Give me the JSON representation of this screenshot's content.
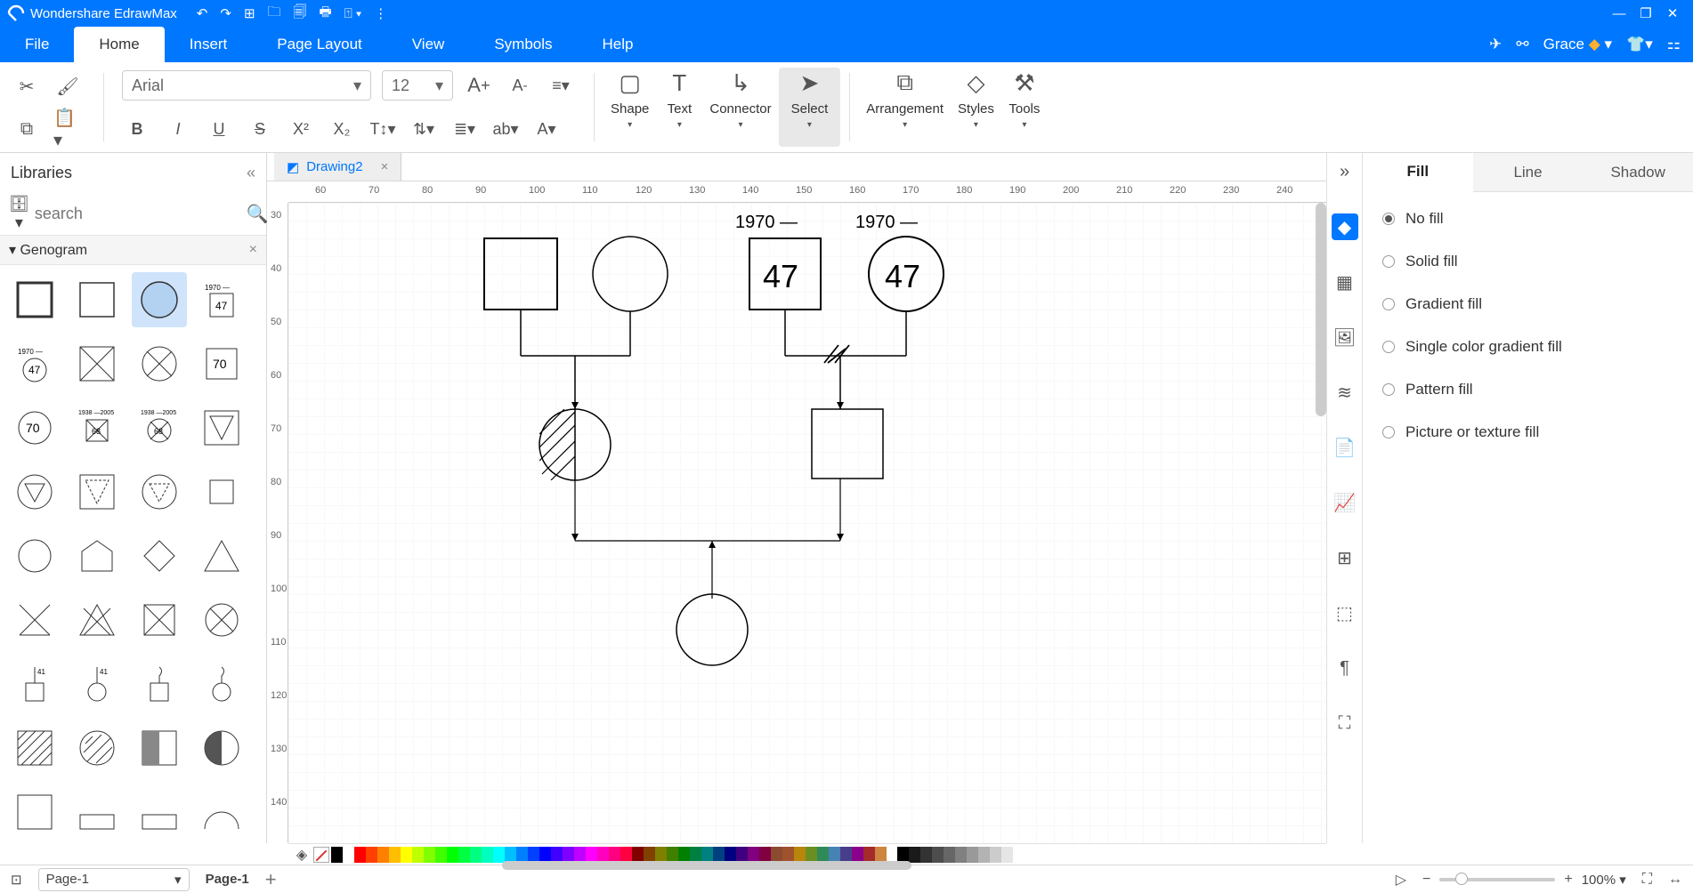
{
  "app": {
    "title": "Wondershare EdrawMax"
  },
  "titlebar_icons": [
    "undo",
    "redo",
    "new",
    "open",
    "recent",
    "print",
    "export",
    "more"
  ],
  "menus": [
    "File",
    "Home",
    "Insert",
    "Page Layout",
    "View",
    "Symbols",
    "Help"
  ],
  "active_menu": "Home",
  "user": {
    "name": "Grace"
  },
  "font": {
    "family": "Arial",
    "size": "12"
  },
  "ribbon": {
    "shape": "Shape",
    "text": "Text",
    "connector": "Connector",
    "select": "Select",
    "arrangement": "Arrangement",
    "styles": "Styles",
    "tools": "Tools"
  },
  "libraries": {
    "title": "Libraries",
    "search_placeholder": "search",
    "category": "Genogram"
  },
  "doc_tab": "Drawing2",
  "ruler_x": [
    "60",
    "70",
    "80",
    "90",
    "100",
    "110",
    "120",
    "130",
    "140",
    "150",
    "160",
    "170",
    "180",
    "190",
    "200",
    "210",
    "220",
    "230",
    "240"
  ],
  "ruler_y": [
    "30",
    "40",
    "50",
    "60",
    "70",
    "80",
    "90",
    "100",
    "110",
    "120",
    "130",
    "140"
  ],
  "canvas": {
    "label1970a": "1970 —",
    "label1970b": "1970 —",
    "num47a": "47",
    "num47b": "47"
  },
  "rightpanel": {
    "tabs": [
      "Fill",
      "Line",
      "Shadow"
    ],
    "active": "Fill",
    "options": [
      "No fill",
      "Solid fill",
      "Gradient fill",
      "Single color gradient fill",
      "Pattern fill",
      "Picture or texture fill"
    ],
    "selected": "No fill"
  },
  "colorbar": [
    "#000000",
    "#ffffff",
    "#ff0000",
    "#ff4000",
    "#ff8000",
    "#ffbf00",
    "#ffff00",
    "#bfff00",
    "#80ff00",
    "#40ff00",
    "#00ff00",
    "#00ff40",
    "#00ff80",
    "#00ffbf",
    "#00ffff",
    "#00bfff",
    "#0080ff",
    "#0040ff",
    "#0000ff",
    "#4000ff",
    "#8000ff",
    "#bf00ff",
    "#ff00ff",
    "#ff00bf",
    "#ff0080",
    "#ff0040",
    "#800000",
    "#804000",
    "#808000",
    "#408000",
    "#008000",
    "#008040",
    "#008080",
    "#004080",
    "#000080",
    "#400080",
    "#800080",
    "#800040",
    "#8c4a2e",
    "#a0522d",
    "#b8860b",
    "#6b8e23",
    "#2e8b57",
    "#4682b4",
    "#483d8b",
    "#8b008b",
    "#a52a2a",
    "#cd853f"
  ],
  "grays": [
    "#000000",
    "#1a1a1a",
    "#333333",
    "#4d4d4d",
    "#666666",
    "#808080",
    "#999999",
    "#b3b3b3",
    "#cccccc",
    "#e6e6e6",
    "#ffffff"
  ],
  "status": {
    "page_sel": "Page-1",
    "page_tab": "Page-1",
    "zoom": "100%"
  }
}
